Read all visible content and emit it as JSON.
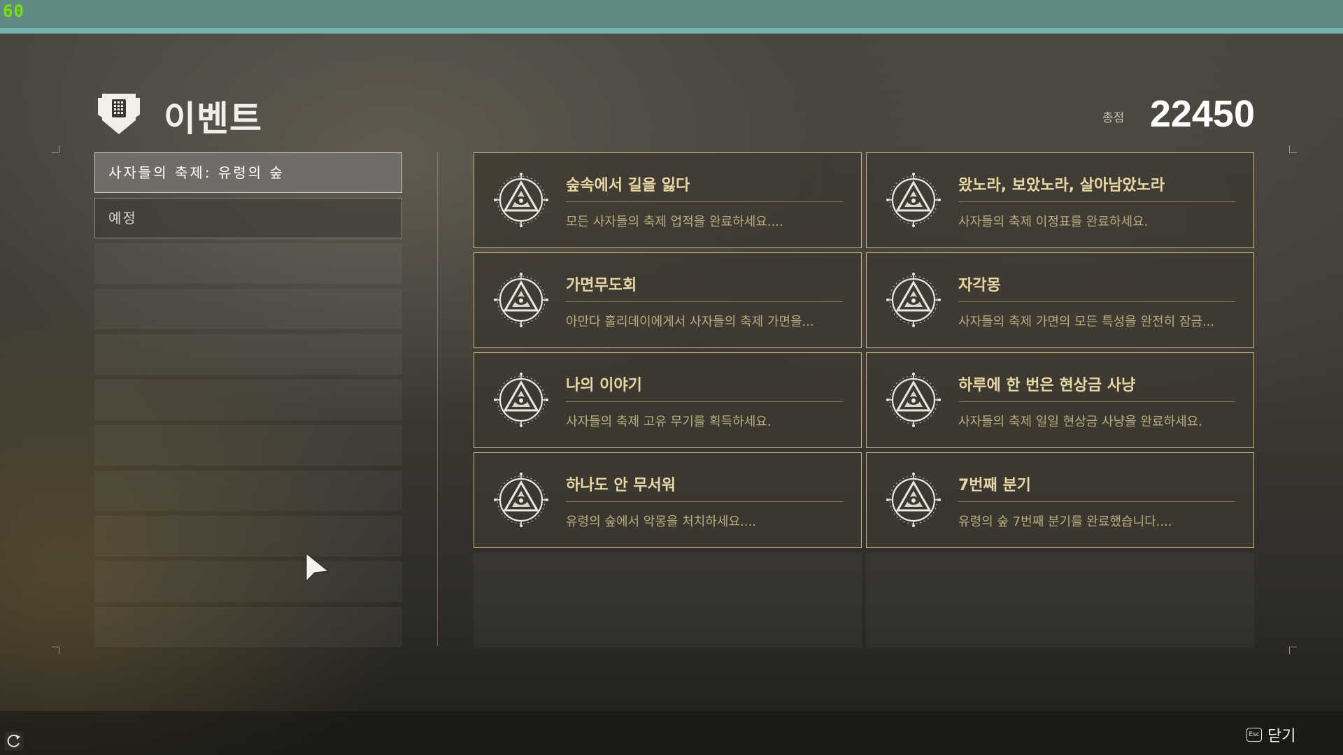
{
  "overlay": {
    "fps": "60"
  },
  "header": {
    "title": "이벤트",
    "score_label": "총점",
    "score_value": "22450"
  },
  "sidebar": {
    "items": [
      {
        "label": "사자들의 축제: 유령의 숲",
        "active": true
      },
      {
        "label": "예정",
        "active": false
      }
    ]
  },
  "cards": [
    {
      "title": "숲속에서 길을 잃다",
      "desc": "모든 사자들의 축제 업적을 완료하세요...."
    },
    {
      "title": "왔노라, 보았노라, 살아남았노라",
      "desc": "사자들의 축제 이정표를 완료하세요."
    },
    {
      "title": "가면무도회",
      "desc": "아만다 홀리데이에게서 사자들의 축제 가면을..."
    },
    {
      "title": "자각몽",
      "desc": "사자들의 축제 가면의 모든 특성을 완전히 잠금..."
    },
    {
      "title": "나의 이야기",
      "desc": "사자들의 축제 고유 무기를 획득하세요."
    },
    {
      "title": "하루에 한 번은 현상금 사냥",
      "desc": "사자들의 축제 일일 현상금 사냥을 완료하세요."
    },
    {
      "title": "하나도 안 무서워",
      "desc": "유령의 숲에서 악몽을 처치하세요...."
    },
    {
      "title": "7번째 분기",
      "desc": "유령의 숲 7번째 분기를 완료했습니다...."
    }
  ],
  "footer": {
    "esc_key": "Esc",
    "close_label": "닫기"
  },
  "icons": {
    "header": "event-shield-icon",
    "card": "festival-emblem-icon",
    "refresh": "refresh-icon",
    "cursor": "mouse-cursor-icon"
  },
  "colors": {
    "top_bar": "#5e8b86",
    "card_border": "#c8b88a",
    "card_title": "#e8d7a6"
  }
}
